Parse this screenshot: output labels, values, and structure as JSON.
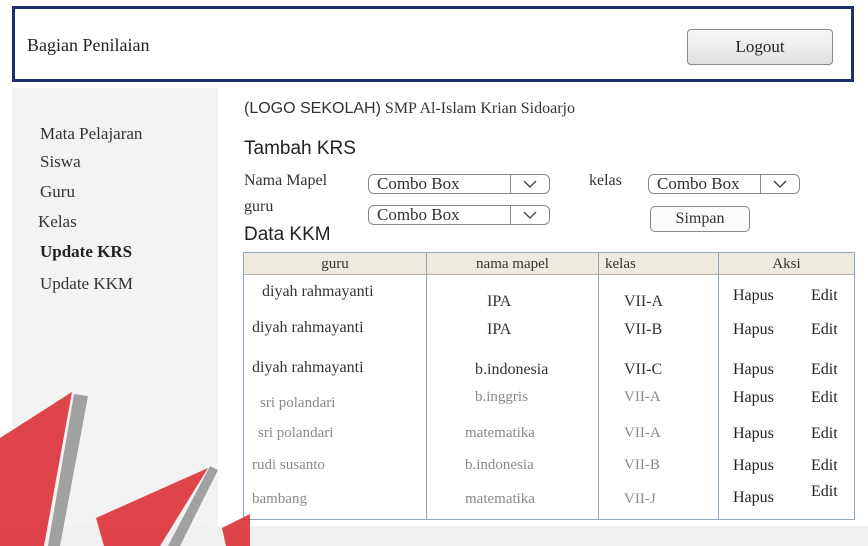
{
  "header": {
    "title": "Bagian Penilaian",
    "logout_label": "Logout"
  },
  "sidebar": {
    "items": [
      {
        "label": "Mata Pelajaran"
      },
      {
        "label": "Siswa"
      },
      {
        "label": "Guru"
      },
      {
        "label": "Kelas"
      },
      {
        "label": "Update KRS"
      },
      {
        "label": "Update KKM"
      }
    ],
    "active": "Update KRS"
  },
  "main": {
    "school_logo": "(LOGO SEKOLAH)",
    "school_name": "SMP Al-Islam Krian Sidoarjo",
    "form": {
      "title": "Tambah KRS",
      "nama_mapel_label": "Nama Mapel",
      "nama_mapel_value": "Combo Box",
      "guru_label": "guru",
      "guru_value": "Combo Box",
      "kelas_label": "kelas",
      "kelas_value": "Combo Box",
      "simpan_label": "Simpan"
    },
    "table": {
      "title": "Data KKM",
      "columns": [
        "guru",
        "nama mapel",
        "kelas",
        "Aksi"
      ],
      "rows": [
        {
          "guru": "diyah rahmayanti",
          "mapel": "IPA",
          "kelas": "VII-A",
          "hapus": "Hapus",
          "edit": "Edit"
        },
        {
          "guru": "diyah rahmayanti",
          "mapel": "IPA",
          "kelas": "VII-B",
          "hapus": "Hapus",
          "edit": "Edit"
        },
        {
          "guru": "diyah rahmayanti",
          "mapel": "b.indonesia",
          "kelas": "VII-C",
          "hapus": "Hapus",
          "edit": "Edit"
        },
        {
          "guru": "sri polandari",
          "mapel": "b.inggris",
          "kelas": "VII-A",
          "hapus": "Hapus",
          "edit": "Edit"
        },
        {
          "guru": "sri polandari",
          "mapel": "matematika",
          "kelas": "VII-A",
          "hapus": "Hapus",
          "edit": "Edit"
        },
        {
          "guru": "rudi susanto",
          "mapel": "b.indonesia",
          "kelas": "VII-B",
          "hapus": "Hapus",
          "edit": "Edit"
        },
        {
          "guru": "bambang",
          "mapel": "matematika",
          "kelas": "VII-J",
          "hapus": "Hapus",
          "edit": "Edit"
        }
      ]
    }
  },
  "colors": {
    "header_border": "#1f2d6b",
    "table_border": "#8fa8c0",
    "table_header_bg": "#eeeadf",
    "watermark_red": "#d9252b",
    "watermark_gray": "#8c8c8c"
  }
}
